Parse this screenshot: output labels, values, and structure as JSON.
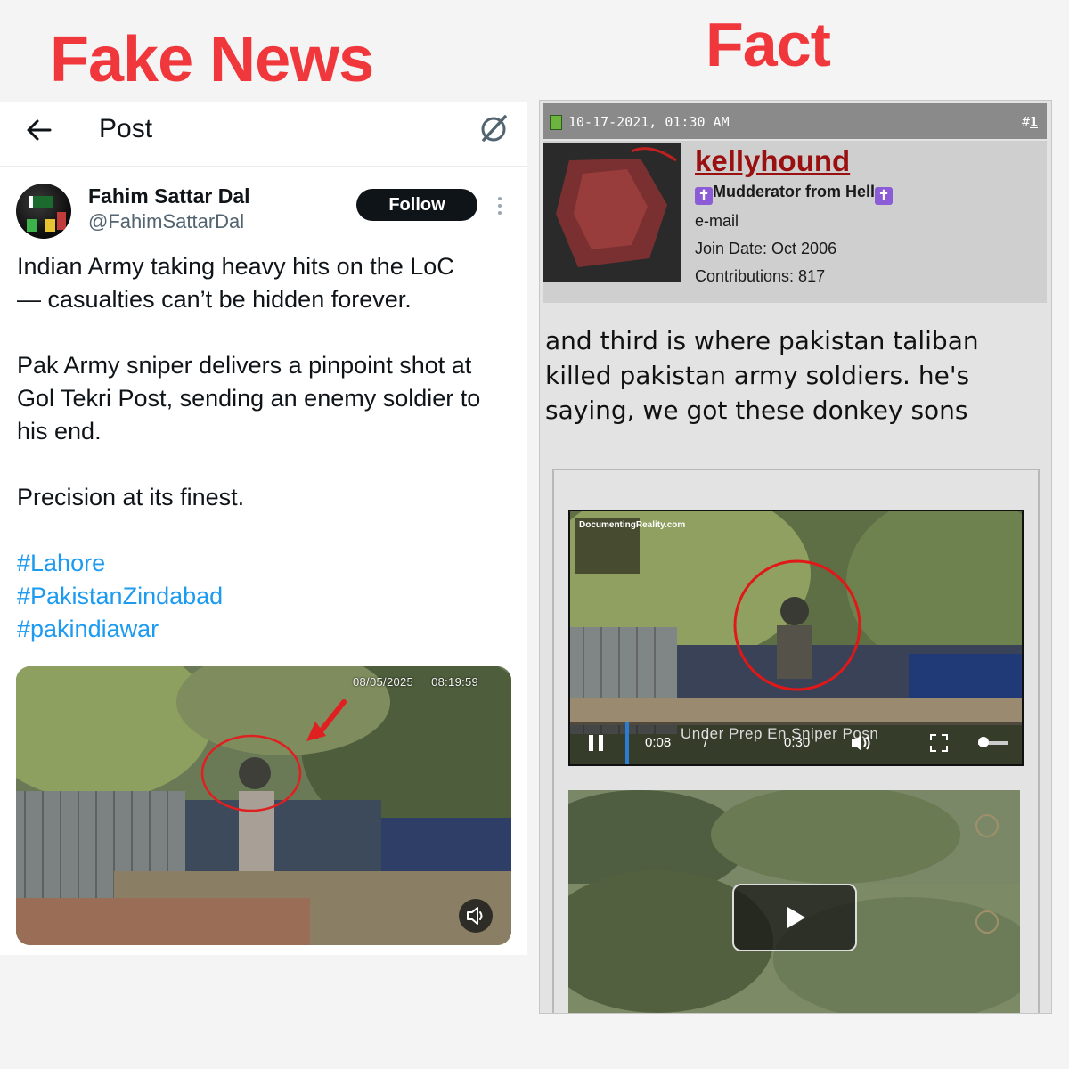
{
  "headings": {
    "left": "Fake News",
    "right": "Fact",
    "color": "#f0373c"
  },
  "tweet": {
    "topbar": {
      "title": "Post",
      "back_icon": "arrow-left-icon",
      "action_icon": "grok-icon"
    },
    "author": {
      "name": "Fahim Sattar Dal",
      "handle": "@FahimSattarDal",
      "follow_label": "Follow"
    },
    "text": {
      "p1_line1": "Indian Army taking heavy hits on the LoC",
      "p1_line2": "— casualties can’t be hidden forever.",
      "p2_line1": "Pak Army sniper delivers a pinpoint shot at",
      "p2_line2": "Gol Tekri Post, sending an enemy soldier to",
      "p2_line3": "his end.",
      "p3": "Precision at its finest."
    },
    "hashtags": [
      "#Lahore",
      "#PakistanZindabad",
      "#pakindiawar"
    ],
    "media": {
      "date": "08/05/2025",
      "time": "08:19:59",
      "icon": "speaker-icon"
    },
    "colors": {
      "link": "#1d9bf0",
      "text": "#0f1419",
      "muted": "#536471"
    }
  },
  "forum": {
    "post_header": {
      "date": "10-17-2021, 01:30 AM",
      "number_prefix": "#",
      "number": "1"
    },
    "user": {
      "name": "kellyhound",
      "rank": "Mudderator from Hell",
      "email": "e-mail",
      "join_date": "Join Date: Oct 2006",
      "contributions": "Contributions: 817"
    },
    "message": {
      "line1": "and third is where pakistan taliban",
      "line2": "killed pakistan army soldiers. he's",
      "line3": "saying, we got these donkey sons"
    },
    "video1": {
      "watermark": "DocumentingReality.com",
      "current_time": "0:08",
      "separator": "/",
      "total_time": "0:30",
      "caption": "Under Prep En Sniper Posn"
    },
    "video2": {
      "icon": "play-icon"
    },
    "colors": {
      "username": "#9a1010",
      "header_bg": "#8a8a8a"
    }
  }
}
